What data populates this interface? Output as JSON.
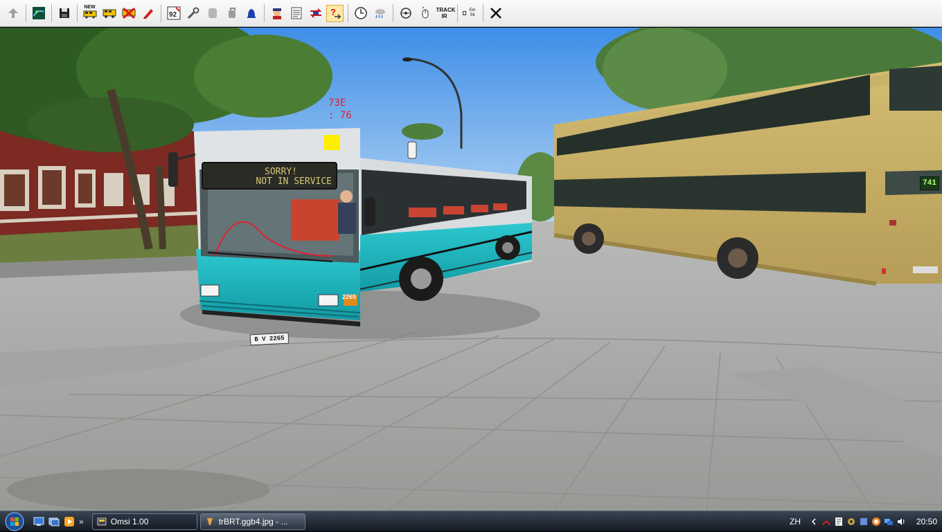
{
  "toolbar": {
    "buttons": [
      {
        "name": "up-arrow-icon"
      },
      {
        "name": "map-icon"
      },
      {
        "name": "save-icon"
      },
      {
        "name": "new-bus-icon",
        "label": "NEW"
      },
      {
        "name": "bus-icon"
      },
      {
        "name": "remove-bus-icon"
      },
      {
        "name": "pen-icon"
      },
      {
        "name": "timetable-icon",
        "label": "92"
      },
      {
        "name": "wrench-icon"
      },
      {
        "name": "gray-tool-icon"
      },
      {
        "name": "gray-tool-2-icon"
      },
      {
        "name": "bell-icon"
      },
      {
        "name": "driver-icon"
      },
      {
        "name": "ticket-icon"
      },
      {
        "name": "switch-icon"
      },
      {
        "name": "help-icon"
      },
      {
        "name": "clock-icon"
      },
      {
        "name": "weather-icon"
      },
      {
        "name": "camera-icon"
      },
      {
        "name": "mouse-icon"
      },
      {
        "name": "trackir-icon",
        "label": "TRACK IR"
      },
      {
        "name": "text-icon",
        "label": "Ein Sit"
      },
      {
        "name": "close-icon"
      }
    ]
  },
  "scene": {
    "overlay_line1": "73E",
    "overlay_line2": ": 76",
    "destination_line1": "SORRY!",
    "destination_line2": "NOT IN SERVICE",
    "plate": "B V 2265",
    "fleet_number": "2265",
    "route_sign": "741"
  },
  "taskbar": {
    "tasks": [
      {
        "label": "Omsi 1.00",
        "active": true
      },
      {
        "label": "trBRT.ggb4.jpg - ...",
        "active": false
      }
    ],
    "language": "ZH",
    "clock": "20:50"
  },
  "colors": {
    "bus_teal": "#1fb3bd",
    "toolbar_bg": "#f0f0f0",
    "taskbar_bg": "#1e2530"
  }
}
